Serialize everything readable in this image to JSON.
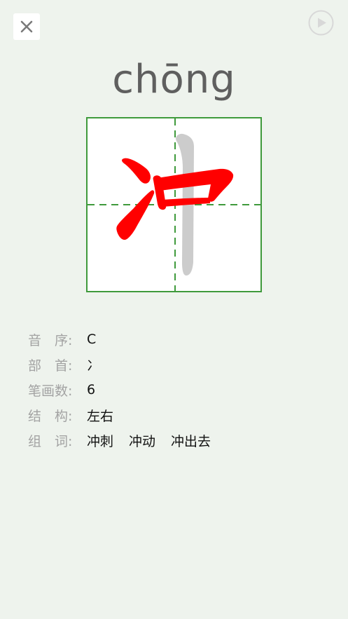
{
  "header": {
    "close_icon": "close-icon",
    "play_icon": "play-icon"
  },
  "pinyin": "chōng",
  "character": {
    "glyph": "冲",
    "stroke_color_active": "#ff0000",
    "stroke_color_pending": "#cccccc",
    "grid_color": "#3f9a3c"
  },
  "info": {
    "sequence": {
      "label": "音　序:",
      "value": "C"
    },
    "radical": {
      "label": "部　首:",
      "value": "冫"
    },
    "stroke_count": {
      "label": "笔画数:",
      "value": "6"
    },
    "structure": {
      "label": "结　构:",
      "value": "左右"
    },
    "words": {
      "label": "组　词:",
      "values": [
        "冲刺",
        "冲动",
        "冲出去"
      ]
    }
  }
}
